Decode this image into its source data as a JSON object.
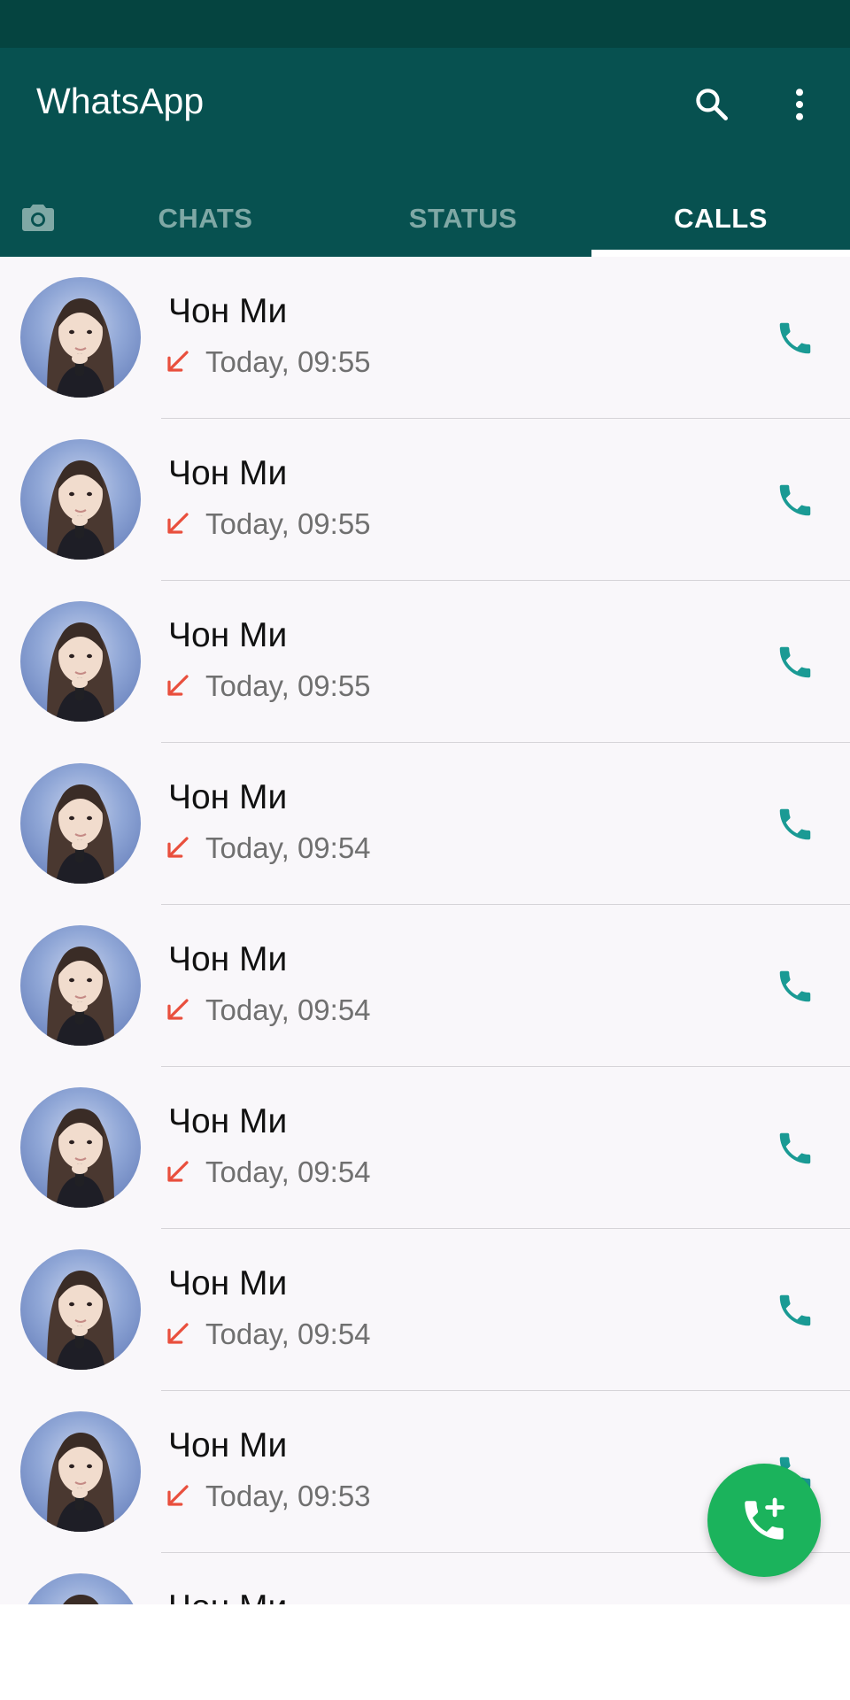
{
  "app": {
    "title": "WhatsApp",
    "accent_color": "#075150",
    "status_bar_color": "#054440",
    "call_icon_color": "#1a9a94",
    "missed_call_color": "#e94f3d",
    "fab_color": "#1bb35c"
  },
  "toolbar": {
    "search_icon": "search-icon",
    "more_icon": "more-vert-icon"
  },
  "tabs": {
    "camera_icon": "camera-icon",
    "items": [
      {
        "label": "CHATS",
        "active": false
      },
      {
        "label": "STATUS",
        "active": false
      },
      {
        "label": "CALLS",
        "active": true
      }
    ]
  },
  "calls": [
    {
      "name": "Чон Ми",
      "time": "Today, 09:55",
      "direction": "incoming-missed"
    },
    {
      "name": "Чон Ми",
      "time": "Today, 09:55",
      "direction": "incoming-missed"
    },
    {
      "name": "Чон Ми",
      "time": "Today, 09:55",
      "direction": "incoming-missed"
    },
    {
      "name": "Чон Ми",
      "time": "Today, 09:54",
      "direction": "incoming-missed"
    },
    {
      "name": "Чон Ми",
      "time": "Today, 09:54",
      "direction": "incoming-missed"
    },
    {
      "name": "Чон Ми",
      "time": "Today, 09:54",
      "direction": "incoming-missed"
    },
    {
      "name": "Чон Ми",
      "time": "Today, 09:54",
      "direction": "incoming-missed"
    },
    {
      "name": "Чон Ми",
      "time": "Today, 09:53",
      "direction": "incoming-missed"
    },
    {
      "name": "Чон Ми",
      "time": "",
      "direction": "incoming-missed"
    }
  ],
  "fab": {
    "icon": "add-call-icon"
  }
}
